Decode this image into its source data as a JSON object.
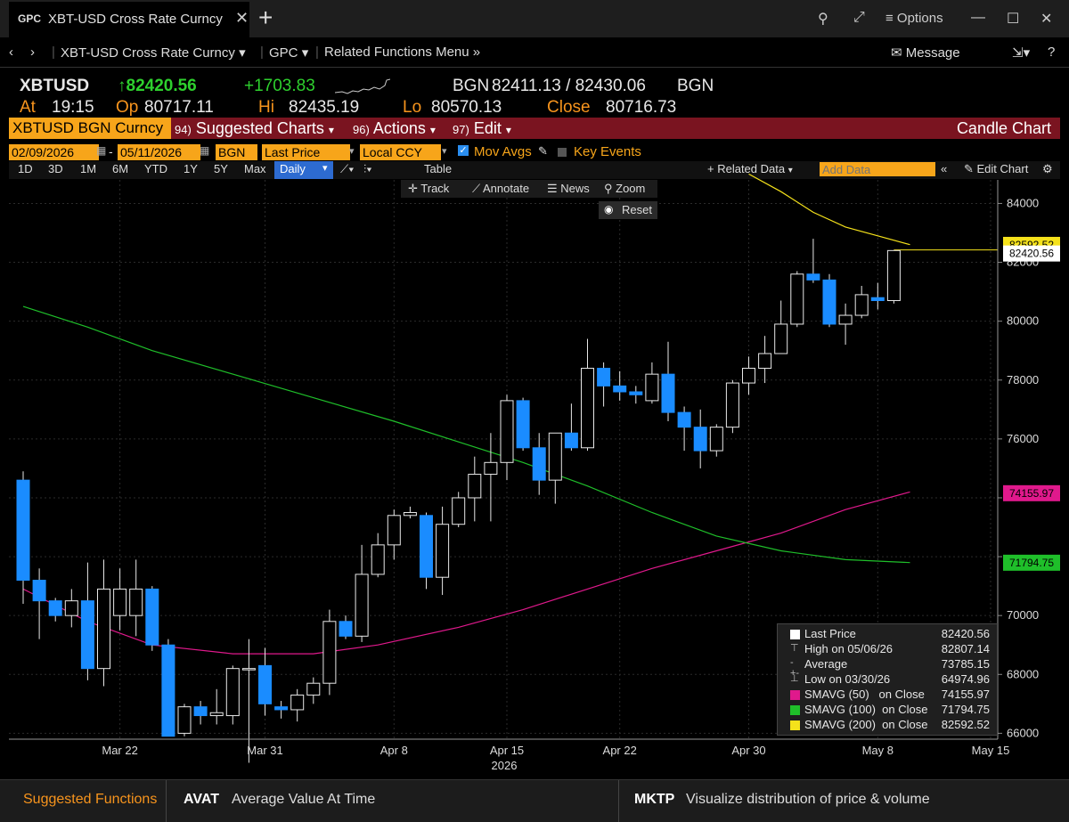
{
  "window": {
    "tab_code": "GPC",
    "tab_title": "XBT-USD Cross Rate Curncy",
    "options_label": "Options"
  },
  "nav": {
    "security": "XBT-USD Cross Rate Curncy",
    "function": "GPC",
    "related_menu": "Related Functions Menu",
    "message": "Message"
  },
  "quote": {
    "ticker": "XBTUSD",
    "last": "82420.56",
    "change": "+1703.83",
    "source": "BGN",
    "bid_ask": "82411.13 / 82430.06",
    "source2": "BGN",
    "at_label": "At",
    "at_time": "19:15",
    "open_label": "Op",
    "open": "80717.11",
    "high_label": "Hi",
    "high": "82435.19",
    "low_label": "Lo",
    "low": "80570.13",
    "close_label": "Close",
    "close": "80716.73"
  },
  "function_bar": {
    "security": "XBTUSD BGN Curncy",
    "items": [
      {
        "num": "94)",
        "label": "Suggested Charts"
      },
      {
        "num": "96)",
        "label": "Actions"
      },
      {
        "num": "97)",
        "label": "Edit"
      }
    ],
    "chart_type": "Candle Chart"
  },
  "settings": {
    "start_date": "02/09/2026",
    "end_date": "05/11/2026",
    "source": "BGN",
    "field": "Last Price",
    "currency": "Local CCY",
    "mov_avgs": "Mov Avgs",
    "key_events": "Key Events"
  },
  "toolbar": {
    "ranges": [
      "1D",
      "3D",
      "1M",
      "6M",
      "YTD",
      "1Y",
      "5Y",
      "Max"
    ],
    "period": "Daily",
    "table": "Table",
    "related_data": "+ Related Data",
    "add_data_placeholder": "Add Data",
    "edit_chart": "Edit Chart",
    "track": "Track",
    "annotate": "Annotate",
    "news": "News",
    "zoom": "Zoom",
    "reset": "Reset"
  },
  "legend": [
    {
      "label": "Last Price",
      "value": "82420.56",
      "color": "#ffffff"
    },
    {
      "label": "High on 05/06/26",
      "value": "82807.14",
      "color": ""
    },
    {
      "label": "Average",
      "value": "73785.15",
      "color": ""
    },
    {
      "label": "Low on 03/30/26",
      "value": "64974.96",
      "color": ""
    },
    {
      "label": "SMAVG (50)   on Close",
      "value": "74155.97",
      "color": "#e0198c"
    },
    {
      "label": "SMAVG (100)  on Close",
      "value": "71794.75",
      "color": "#1fbf2a"
    },
    {
      "label": "SMAVG (200)  on Close",
      "value": "82592.52",
      "color": "#f5e21b"
    }
  ],
  "bottom": {
    "suggested": "Suggested Functions",
    "f1_code": "AVAT",
    "f1_desc": "Average Value At Time",
    "f2_code": "MKTP",
    "f2_desc": "Visualize distribution of price & volume"
  },
  "chart_data": {
    "type": "candlestick",
    "ylim": [
      65800,
      84800
    ],
    "yticks": [
      66000,
      68000,
      70000,
      72000,
      74000,
      76000,
      78000,
      80000,
      82000,
      84000
    ],
    "ytick_labels": [
      "66000",
      "68000",
      "70000",
      "",
      "",
      "76000",
      "78000",
      "80000",
      "82000",
      "84000"
    ],
    "xtick_labels": [
      {
        "label": "Mar 22",
        "date": "2026-03-22"
      },
      {
        "label": "Mar 31",
        "date": "2026-03-31"
      },
      {
        "label": "Apr 8",
        "date": "2026-04-08"
      },
      {
        "label": "Apr 15",
        "date": "2026-04-15"
      },
      {
        "label": "Apr 22",
        "date": "2026-04-22"
      },
      {
        "label": "Apr 30",
        "date": "2026-04-30"
      },
      {
        "label": "May 8",
        "date": "2026-05-08"
      },
      {
        "label": "May 15",
        "date": "2026-05-15"
      }
    ],
    "year_label": "2026",
    "candles": [
      {
        "date": "2026-03-16",
        "open": 74600,
        "high": 74900,
        "low": 70400,
        "close": 71200
      },
      {
        "date": "2026-03-17",
        "open": 71200,
        "high": 71600,
        "low": 69200,
        "close": 70500
      },
      {
        "date": "2026-03-18",
        "open": 70500,
        "high": 70600,
        "low": 69800,
        "close": 70000
      },
      {
        "date": "2026-03-19",
        "open": 70000,
        "high": 70900,
        "low": 69600,
        "close": 70500
      },
      {
        "date": "2026-03-20",
        "open": 70500,
        "high": 71800,
        "low": 67800,
        "close": 68200
      },
      {
        "date": "2026-03-21",
        "open": 68200,
        "high": 71900,
        "low": 67600,
        "close": 70900
      },
      {
        "date": "2026-03-22",
        "open": 70000,
        "high": 71600,
        "low": 69500,
        "close": 70900
      },
      {
        "date": "2026-03-23",
        "open": 70000,
        "high": 71900,
        "low": 69300,
        "close": 70900
      },
      {
        "date": "2026-03-24",
        "open": 70900,
        "high": 71000,
        "low": 68800,
        "close": 69000
      },
      {
        "date": "2026-03-25",
        "open": 69000,
        "high": 69200,
        "low": 65900,
        "close": 65900
      },
      {
        "date": "2026-03-26",
        "open": 66000,
        "high": 67000,
        "low": 65900,
        "close": 66900
      },
      {
        "date": "2026-03-27",
        "open": 66900,
        "high": 67100,
        "low": 66300,
        "close": 66600
      },
      {
        "date": "2026-03-28",
        "open": 66600,
        "high": 67500,
        "low": 66300,
        "close": 66700
      },
      {
        "date": "2026-03-29",
        "open": 66600,
        "high": 68300,
        "low": 66300,
        "close": 68200
      },
      {
        "date": "2026-03-30",
        "open": 68200,
        "high": 69200,
        "low": 65000,
        "close": 68200
      },
      {
        "date": "2026-03-31",
        "open": 68300,
        "high": 68900,
        "low": 66600,
        "close": 67000
      },
      {
        "date": "2026-04-01",
        "open": 66900,
        "high": 67100,
        "low": 66500,
        "close": 66800
      },
      {
        "date": "2026-04-02",
        "open": 66800,
        "high": 67500,
        "low": 66400,
        "close": 67300
      },
      {
        "date": "2026-04-03",
        "open": 67300,
        "high": 67900,
        "low": 67000,
        "close": 67700
      },
      {
        "date": "2026-04-04",
        "open": 67700,
        "high": 70200,
        "low": 67300,
        "close": 69800
      },
      {
        "date": "2026-04-05",
        "open": 69800,
        "high": 70000,
        "low": 69200,
        "close": 69300
      },
      {
        "date": "2026-04-06",
        "open": 69300,
        "high": 72400,
        "low": 69100,
        "close": 71400
      },
      {
        "date": "2026-04-07",
        "open": 71400,
        "high": 72800,
        "low": 71300,
        "close": 72400
      },
      {
        "date": "2026-04-08",
        "open": 72400,
        "high": 73600,
        "low": 71900,
        "close": 73400
      },
      {
        "date": "2026-04-09",
        "open": 73400,
        "high": 73700,
        "low": 73300,
        "close": 73500
      },
      {
        "date": "2026-04-10",
        "open": 73400,
        "high": 73500,
        "low": 70900,
        "close": 71300
      },
      {
        "date": "2026-04-11",
        "open": 71300,
        "high": 73700,
        "low": 70700,
        "close": 73100
      },
      {
        "date": "2026-04-12",
        "open": 73100,
        "high": 74200,
        "low": 73000,
        "close": 74000
      },
      {
        "date": "2026-04-13",
        "open": 74000,
        "high": 75400,
        "low": 73200,
        "close": 74800
      },
      {
        "date": "2026-04-14",
        "open": 74800,
        "high": 76200,
        "low": 73200,
        "close": 75200
      },
      {
        "date": "2026-04-15",
        "open": 75200,
        "high": 77500,
        "low": 74600,
        "close": 77300
      },
      {
        "date": "2026-04-16",
        "open": 77300,
        "high": 77400,
        "low": 75600,
        "close": 75700
      },
      {
        "date": "2026-04-17",
        "open": 75700,
        "high": 76200,
        "low": 74100,
        "close": 74600
      },
      {
        "date": "2026-04-18",
        "open": 74600,
        "high": 76200,
        "low": 73800,
        "close": 76200
      },
      {
        "date": "2026-04-19",
        "open": 76200,
        "high": 77200,
        "low": 75600,
        "close": 75700
      },
      {
        "date": "2026-04-20",
        "open": 75700,
        "high": 79400,
        "low": 75600,
        "close": 78400
      },
      {
        "date": "2026-04-21",
        "open": 78400,
        "high": 78600,
        "low": 77100,
        "close": 77800
      },
      {
        "date": "2026-04-22",
        "open": 77800,
        "high": 78300,
        "low": 77300,
        "close": 77600
      },
      {
        "date": "2026-04-23",
        "open": 77600,
        "high": 77800,
        "low": 77200,
        "close": 77500
      },
      {
        "date": "2026-04-24",
        "open": 77300,
        "high": 78600,
        "low": 77200,
        "close": 78200
      },
      {
        "date": "2026-04-25",
        "open": 78200,
        "high": 79300,
        "low": 76600,
        "close": 76900
      },
      {
        "date": "2026-04-26",
        "open": 76900,
        "high": 77100,
        "low": 75600,
        "close": 76400
      },
      {
        "date": "2026-04-27",
        "open": 76400,
        "high": 77000,
        "low": 75000,
        "close": 75600
      },
      {
        "date": "2026-04-28",
        "open": 75600,
        "high": 76500,
        "low": 75400,
        "close": 76400
      },
      {
        "date": "2026-04-29",
        "open": 76400,
        "high": 78000,
        "low": 76200,
        "close": 77900
      },
      {
        "date": "2026-04-30",
        "open": 77900,
        "high": 78800,
        "low": 77500,
        "close": 78400
      },
      {
        "date": "2026-05-01",
        "open": 78400,
        "high": 79500,
        "low": 77900,
        "close": 78900
      },
      {
        "date": "2026-05-02",
        "open": 78900,
        "high": 80700,
        "low": 78900,
        "close": 79900
      },
      {
        "date": "2026-05-03",
        "open": 79900,
        "high": 81700,
        "low": 79800,
        "close": 81600
      },
      {
        "date": "2026-05-04",
        "open": 81600,
        "high": 82800,
        "low": 81300,
        "close": 81400
      },
      {
        "date": "2026-05-05",
        "open": 81400,
        "high": 81600,
        "low": 79800,
        "close": 79900
      },
      {
        "date": "2026-05-06",
        "open": 79900,
        "high": 80600,
        "low": 79200,
        "close": 80200
      },
      {
        "date": "2026-05-07",
        "open": 80200,
        "high": 81200,
        "low": 80100,
        "close": 80900
      },
      {
        "date": "2026-05-08",
        "open": 80800,
        "high": 81300,
        "low": 80400,
        "close": 80700
      },
      {
        "date": "2026-05-09",
        "open": 80700,
        "high": 82400,
        "low": 80600,
        "close": 82400
      }
    ],
    "series": [
      {
        "name": "SMAVG (50)",
        "color": "#e0198c",
        "points": [
          [
            "2026-03-16",
            70900
          ],
          [
            "2026-03-20",
            69800
          ],
          [
            "2026-03-24",
            69000
          ],
          [
            "2026-03-29",
            68700
          ],
          [
            "2026-04-03",
            68700
          ],
          [
            "2026-04-07",
            69000
          ],
          [
            "2026-04-12",
            69600
          ],
          [
            "2026-04-16",
            70200
          ],
          [
            "2026-04-20",
            70900
          ],
          [
            "2026-04-24",
            71600
          ],
          [
            "2026-04-28",
            72200
          ],
          [
            "2026-05-02",
            72800
          ],
          [
            "2026-05-06",
            73600
          ],
          [
            "2026-05-10",
            74200
          ]
        ]
      },
      {
        "name": "SMAVG (100)",
        "color": "#1fbf2a",
        "points": [
          [
            "2026-03-16",
            80500
          ],
          [
            "2026-03-20",
            79800
          ],
          [
            "2026-03-24",
            79000
          ],
          [
            "2026-03-29",
            78200
          ],
          [
            "2026-04-03",
            77400
          ],
          [
            "2026-04-08",
            76600
          ],
          [
            "2026-04-12",
            75900
          ],
          [
            "2026-04-16",
            75200
          ],
          [
            "2026-04-20",
            74400
          ],
          [
            "2026-04-24",
            73500
          ],
          [
            "2026-04-28",
            72700
          ],
          [
            "2026-05-02",
            72200
          ],
          [
            "2026-05-06",
            71900
          ],
          [
            "2026-05-10",
            71800
          ]
        ]
      },
      {
        "name": "SMAVG (200)",
        "color": "#f5e21b",
        "points": [
          [
            "2026-04-30",
            85000
          ],
          [
            "2026-05-02",
            84400
          ],
          [
            "2026-05-04",
            83700
          ],
          [
            "2026-05-06",
            83200
          ],
          [
            "2026-05-08",
            82900
          ],
          [
            "2026-05-10",
            82600
          ]
        ]
      }
    ],
    "last_price_line": 82420.56,
    "axis_markers": [
      {
        "value": 82592.52,
        "label": "82592.52",
        "color": "#f5e21b"
      },
      {
        "value": 82420.56,
        "label": "82420.56",
        "color": "#ffffff"
      },
      {
        "value": 74155.97,
        "label": "74155.97",
        "color": "#e0198c"
      },
      {
        "value": 71794.75,
        "label": "71794.75",
        "color": "#1fbf2a"
      }
    ]
  }
}
